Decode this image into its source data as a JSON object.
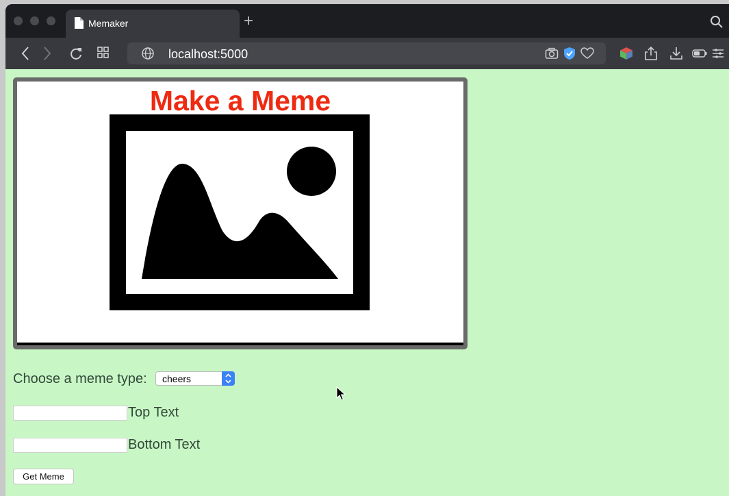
{
  "browser": {
    "tab_title": "Memaker",
    "new_tab_glyph": "+",
    "url": "localhost:5000"
  },
  "meme": {
    "title": "Make a Meme",
    "title_color": "#ee2a12",
    "image_icon": "image-placeholder-icon"
  },
  "form": {
    "type_label": "Choose a meme type:",
    "type_selected": "cheers",
    "top_text_value": "",
    "top_text_label": "Top Text",
    "bottom_text_value": "",
    "bottom_text_label": "Bottom Text",
    "submit_label": "Get Meme"
  },
  "colors": {
    "page_background": "#c8f7c5",
    "select_accent": "#3b82f6",
    "shield_badge": "#4da3ff"
  }
}
